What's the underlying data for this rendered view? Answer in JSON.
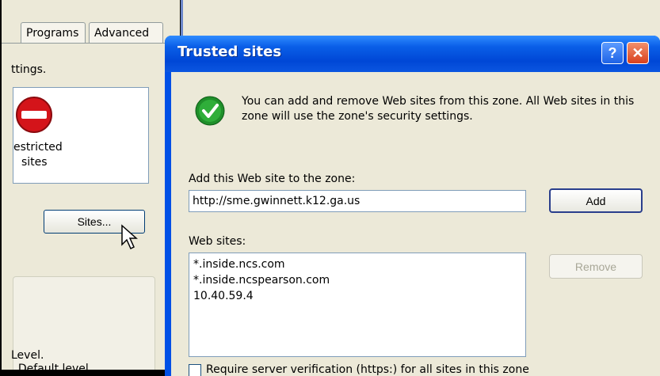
{
  "left_panel": {
    "tabs": [
      "Programs",
      "Advanced"
    ],
    "settings_fragment": "ttings.",
    "zone_label_line1": "estricted",
    "zone_label_line2": "sites",
    "sites_button": "Sites...",
    "level_fragment": "Level.",
    "bottom_fragment": ". Default level"
  },
  "dialog": {
    "title": "Trusted sites",
    "help_label": "?",
    "close_label": "✕",
    "intro": "You can add and remove Web sites from this zone. All Web sites in this zone will use the zone's security settings.",
    "add_label": "Add this Web site to the zone:",
    "url_value": "http://sme.gwinnett.k12.ga.us",
    "add_button": "Add",
    "sites_label": "Web sites:",
    "sites": [
      "*.inside.ncs.com",
      "*.inside.ncspearson.com",
      "10.40.59.4"
    ],
    "remove_button": "Remove",
    "bottom_checkbox_fragment": "Require server verification (https:) for all sites in this zone"
  }
}
